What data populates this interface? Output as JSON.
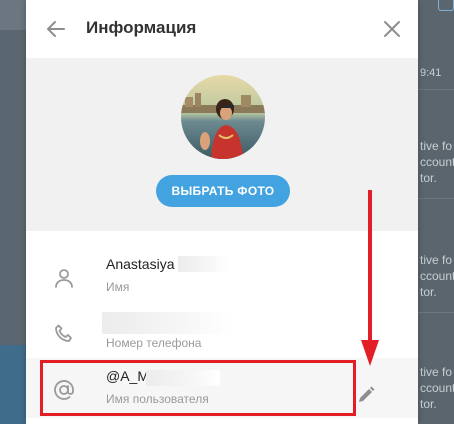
{
  "dialog": {
    "title": "Информация",
    "choose_photo_label": "ВЫБРАТЬ ФОТО"
  },
  "fields": {
    "name": {
      "value": "Anastasiya",
      "label": "Имя"
    },
    "phone": {
      "value": "",
      "label": "Номер телефона"
    },
    "username": {
      "value": "@A_Mo",
      "label": "Имя пользователя"
    }
  },
  "background": {
    "time": "9:41",
    "snippet_lines": [
      [
        "tive fo",
        "ccount",
        "tor."
      ],
      [
        "tive fo",
        "ccount",
        "tor."
      ],
      [
        "tive fo",
        "ccount",
        "tor."
      ]
    ]
  },
  "colors": {
    "accent": "#43a3e0",
    "highlight": "#e21f26",
    "annotation_arrow": "#e21f26"
  },
  "icons": {
    "back": "arrow-left-icon",
    "close": "close-icon",
    "name": "person-icon",
    "phone": "phone-icon",
    "username": "at-sign-icon",
    "edit": "pencil-icon"
  }
}
